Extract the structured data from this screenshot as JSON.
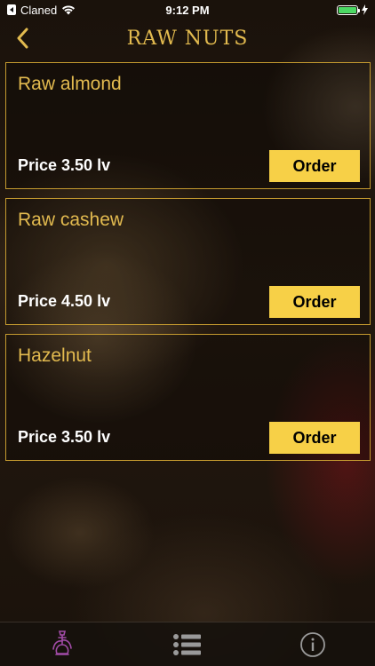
{
  "status_bar": {
    "carrier": "Claned",
    "time": "9:12 PM",
    "battery_level": 1.0
  },
  "nav": {
    "title": "RAW NUTS",
    "back_icon": "chevron-left-icon"
  },
  "products": [
    {
      "name": "Raw almond",
      "price": "Price 3.50 lv",
      "order_label": "Order"
    },
    {
      "name": "Raw cashew",
      "price": "Price 4.50 lv",
      "order_label": "Order"
    },
    {
      "name": "Hazelnut",
      "price": "Price 3.50 lv",
      "order_label": "Order"
    }
  ],
  "tab_bar": {
    "items": [
      {
        "icon": "hookah-icon",
        "active": true
      },
      {
        "icon": "list-icon",
        "active": false
      },
      {
        "icon": "info-icon",
        "active": false
      }
    ]
  },
  "colors": {
    "accent": "#e2ba4f",
    "button": "#f7d047",
    "active_tab": "#a24ca8",
    "border": "#c49a2f"
  }
}
